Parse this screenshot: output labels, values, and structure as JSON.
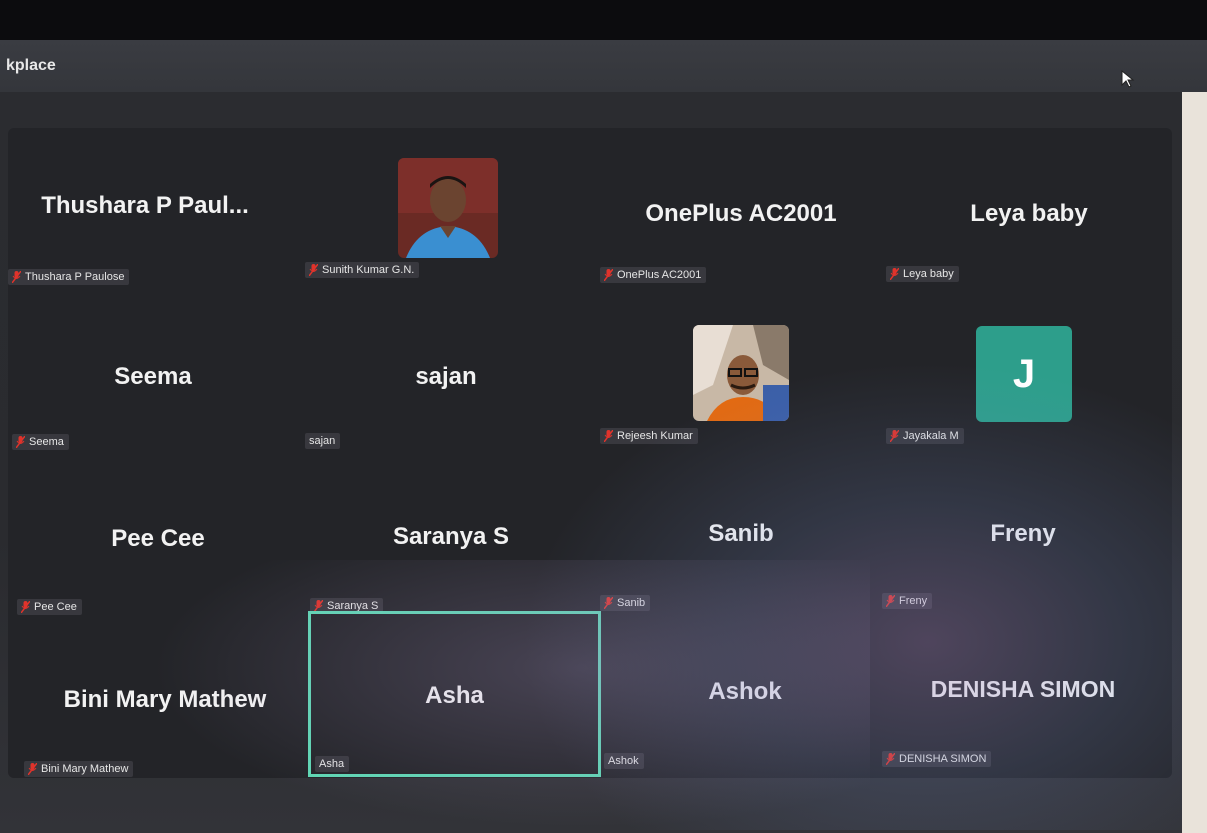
{
  "window": {
    "title": "kplace"
  },
  "participants": [
    {
      "id": "thushara",
      "display": "Thushara  P Paul...",
      "label": "Thushara  P Paulose",
      "muted": true,
      "avatar": "none"
    },
    {
      "id": "sunith",
      "display": "",
      "label": "Sunith Kumar G.N.",
      "muted": true,
      "avatar": "photo-man-blue-shirt"
    },
    {
      "id": "oneplus",
      "display": "OnePlus AC2001",
      "label": "OnePlus AC2001",
      "muted": true,
      "avatar": "none"
    },
    {
      "id": "leya",
      "display": "Leya baby",
      "label": "Leya baby",
      "muted": true,
      "avatar": "none"
    },
    {
      "id": "seema",
      "display": "Seema",
      "label": "Seema",
      "muted": true,
      "avatar": "none"
    },
    {
      "id": "sajan",
      "display": "sajan",
      "label": "sajan",
      "muted": false,
      "avatar": "none"
    },
    {
      "id": "rejeesh",
      "display": "",
      "label": "Rejeesh Kumar",
      "muted": true,
      "avatar": "photo-man-glasses"
    },
    {
      "id": "jayakala",
      "display": "",
      "label": "Jayakala M",
      "muted": true,
      "avatar": "letter",
      "letter": "J",
      "avatar_color": "#2d9e8b"
    },
    {
      "id": "peecee",
      "display": "Pee Cee",
      "label": "Pee Cee",
      "muted": true,
      "avatar": "none"
    },
    {
      "id": "saranya",
      "display": "Saranya S",
      "label": "Saranya S",
      "muted": true,
      "avatar": "none"
    },
    {
      "id": "sanib",
      "display": "Sanib",
      "label": "Sanib",
      "muted": true,
      "avatar": "none"
    },
    {
      "id": "freny",
      "display": "Freny",
      "label": "Freny",
      "muted": true,
      "avatar": "none"
    },
    {
      "id": "bini",
      "display": "Bini Mary Mathew",
      "label": "Bini Mary Mathew",
      "muted": true,
      "avatar": "none"
    },
    {
      "id": "asha",
      "display": "Asha",
      "label": "Asha",
      "muted": false,
      "avatar": "none",
      "active_speaker": true
    },
    {
      "id": "ashok",
      "display": "Ashok",
      "label": "Ashok",
      "muted": false,
      "avatar": "none"
    },
    {
      "id": "denisha",
      "display": "DENISHA SIMON",
      "label": "DENISHA SIMON",
      "muted": true,
      "avatar": "none"
    }
  ],
  "colors": {
    "active_speaker_border": "#5fd7b4",
    "muted_icon": "#e0332b",
    "letter_avatar": "#2d9e8b"
  }
}
